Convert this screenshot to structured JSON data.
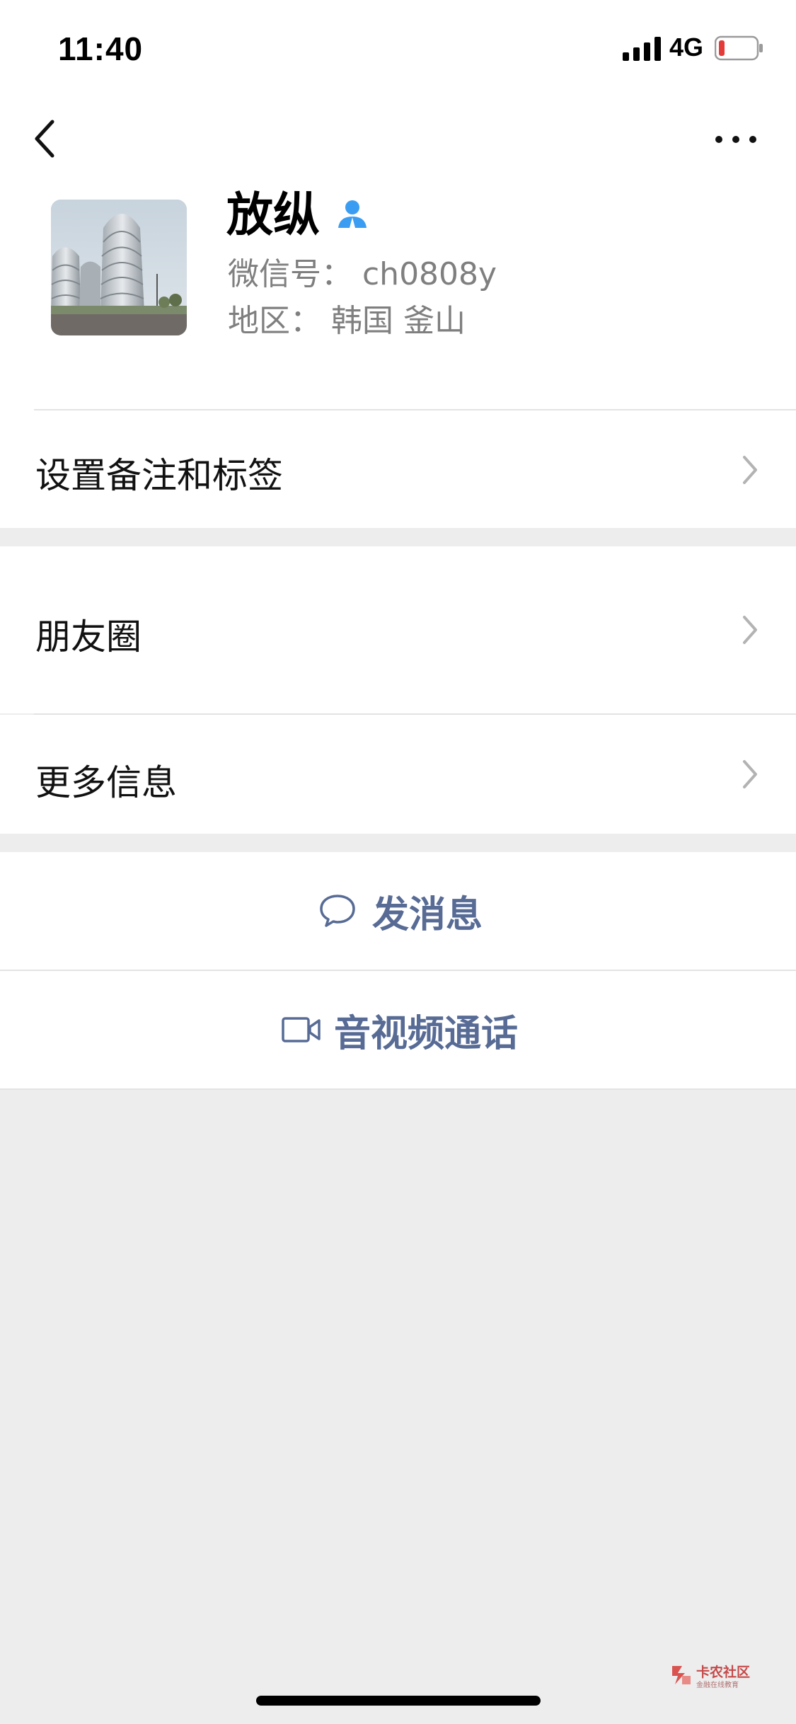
{
  "status_bar": {
    "time": "11:40",
    "network": "4G"
  },
  "nav": {
    "back_icon": "chevron-left-icon",
    "more_icon": "more-dots-icon"
  },
  "profile": {
    "name": "放纵",
    "wechat_id": "微信号：  ch0808y",
    "region": "地区：  韩国  釜山",
    "badge_icon": "contact-person-icon"
  },
  "cells": {
    "remark_tags": "设置备注和标签",
    "moments": "朋友圈",
    "more_info": "更多信息"
  },
  "actions": {
    "send_message": "发消息",
    "av_call": "音视频通话"
  },
  "watermark": {
    "title": "卡农社区",
    "subtitle": "金融在线教育"
  },
  "colors": {
    "link_blue": "#576b95",
    "background": "#ededed",
    "battery_low": "#e33a3a",
    "badge_blue": "#3b9df2"
  }
}
